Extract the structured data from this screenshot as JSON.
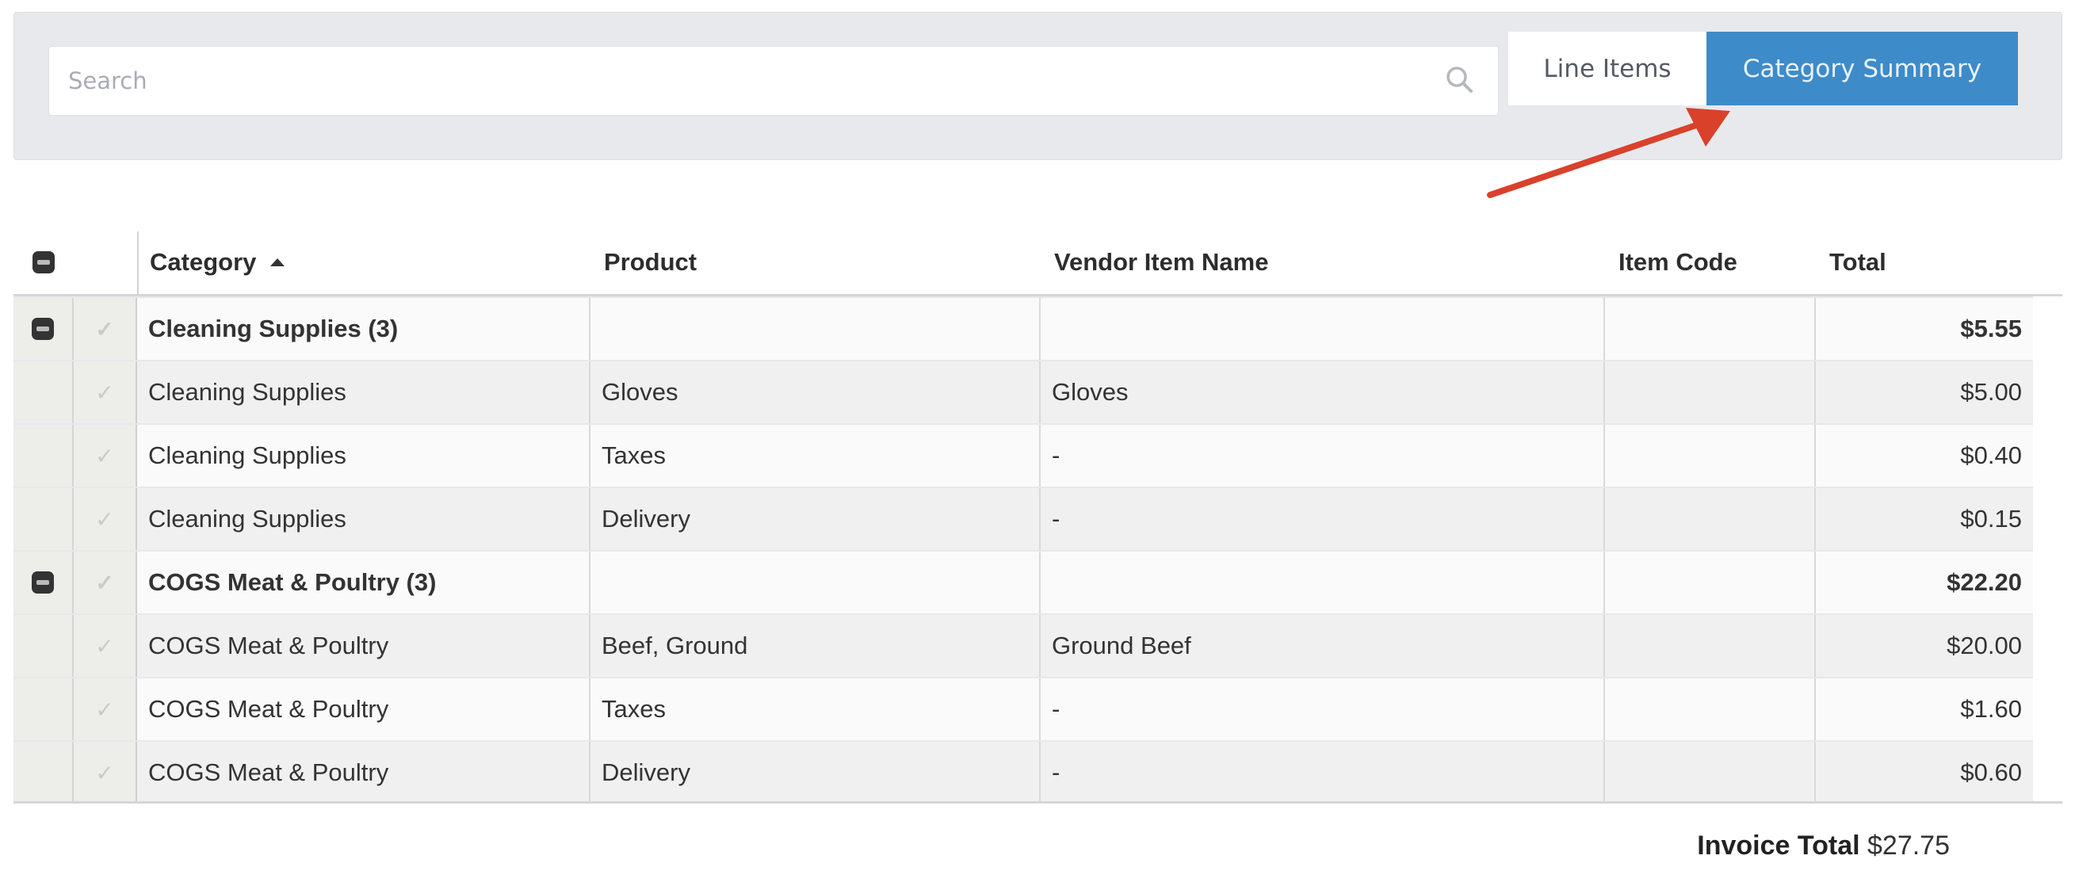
{
  "search": {
    "placeholder": "Search",
    "value": "",
    "icon": "search-icon"
  },
  "view_toggle": {
    "options": [
      {
        "label": "Line Items",
        "active": false
      },
      {
        "label": "Category Summary",
        "active": true
      }
    ],
    "active_color": "#3d8bc9"
  },
  "annotation": {
    "type": "arrow",
    "color": "#d9412b",
    "points_to": "Category Summary"
  },
  "table": {
    "columns": [
      {
        "label": "Category",
        "sort": "ascending",
        "sort_icon": "sort-asc-icon"
      },
      {
        "label": "Product"
      },
      {
        "label": "Vendor Item Name"
      },
      {
        "label": "Item Code"
      },
      {
        "label": "Total"
      }
    ],
    "rows": [
      {
        "group": true,
        "category": "Cleaning Supplies (3)",
        "product": "",
        "vendor": "",
        "code": "",
        "total": "$5.55"
      },
      {
        "group": false,
        "category": "Cleaning Supplies",
        "product": "Gloves",
        "vendor": "Gloves",
        "code": "",
        "total": "$5.00"
      },
      {
        "group": false,
        "category": "Cleaning Supplies",
        "product": "Taxes",
        "vendor": "-",
        "code": "",
        "total": "$0.40"
      },
      {
        "group": false,
        "category": "Cleaning Supplies",
        "product": "Delivery",
        "vendor": "-",
        "code": "",
        "total": "$0.15"
      },
      {
        "group": true,
        "category": "COGS Meat & Poultry (3)",
        "product": "",
        "vendor": "",
        "code": "",
        "total": "$22.20"
      },
      {
        "group": false,
        "category": "COGS Meat & Poultry",
        "product": "Beef, Ground",
        "vendor": "Ground Beef",
        "code": "",
        "total": "$20.00"
      },
      {
        "group": false,
        "category": "COGS Meat & Poultry",
        "product": "Taxes",
        "vendor": "-",
        "code": "",
        "total": "$1.60"
      },
      {
        "group": false,
        "category": "COGS Meat & Poultry",
        "product": "Delivery",
        "vendor": "-",
        "code": "",
        "total": "$0.60"
      }
    ]
  },
  "footer": {
    "invoice_total_label": "Invoice Total",
    "invoice_total_value": "$27.75"
  }
}
